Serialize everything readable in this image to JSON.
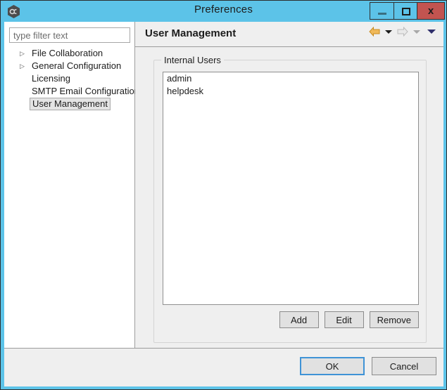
{
  "window": {
    "title": "Preferences",
    "app_icon": "hexagon-app-icon",
    "chrome_color": "#5cc3e8",
    "close_color": "#c25450",
    "controls": [
      {
        "name": "minimize",
        "glyph": "minimize-icon"
      },
      {
        "name": "maximize",
        "glyph": "maximize-icon"
      },
      {
        "name": "close",
        "glyph": "close-icon",
        "label": "x"
      }
    ]
  },
  "sidebar": {
    "filter": {
      "placeholder": "type filter text",
      "value": ""
    },
    "tree": [
      {
        "label": "File Collaboration",
        "arrow": "▷",
        "expandable": true,
        "selected": false
      },
      {
        "label": "General Configuration",
        "arrow": "▷",
        "expandable": true,
        "selected": false
      },
      {
        "label": "Licensing",
        "arrow": "",
        "expandable": false,
        "selected": false
      },
      {
        "label": "SMTP Email Configuration",
        "arrow": "",
        "expandable": false,
        "selected": false
      },
      {
        "label": "User Management",
        "arrow": "",
        "expandable": false,
        "selected": true
      }
    ]
  },
  "content": {
    "page_title": "User Management",
    "nav": [
      {
        "name": "back-arrow-icon",
        "kind": "arrow-left",
        "color": "#e8a33d"
      },
      {
        "name": "back-menu-caret",
        "kind": "caret",
        "color": "#1c1c1c"
      },
      {
        "name": "forward-arrow-icon",
        "kind": "arrow-right",
        "color": "#cccccc"
      },
      {
        "name": "forward-menu-caret",
        "kind": "caret",
        "color": "#a8a8a8"
      },
      {
        "name": "page-menu-caret",
        "kind": "caret",
        "color": "#2f2f6b"
      }
    ],
    "group": {
      "legend": "Internal Users",
      "users": [
        {
          "name": "admin"
        },
        {
          "name": "helpdesk"
        }
      ],
      "buttons": [
        {
          "label": "Add"
        },
        {
          "label": "Edit"
        },
        {
          "label": "Remove"
        }
      ]
    }
  },
  "footer": {
    "buttons": [
      {
        "label": "OK",
        "default": true
      },
      {
        "label": "Cancel",
        "default": false
      }
    ]
  }
}
